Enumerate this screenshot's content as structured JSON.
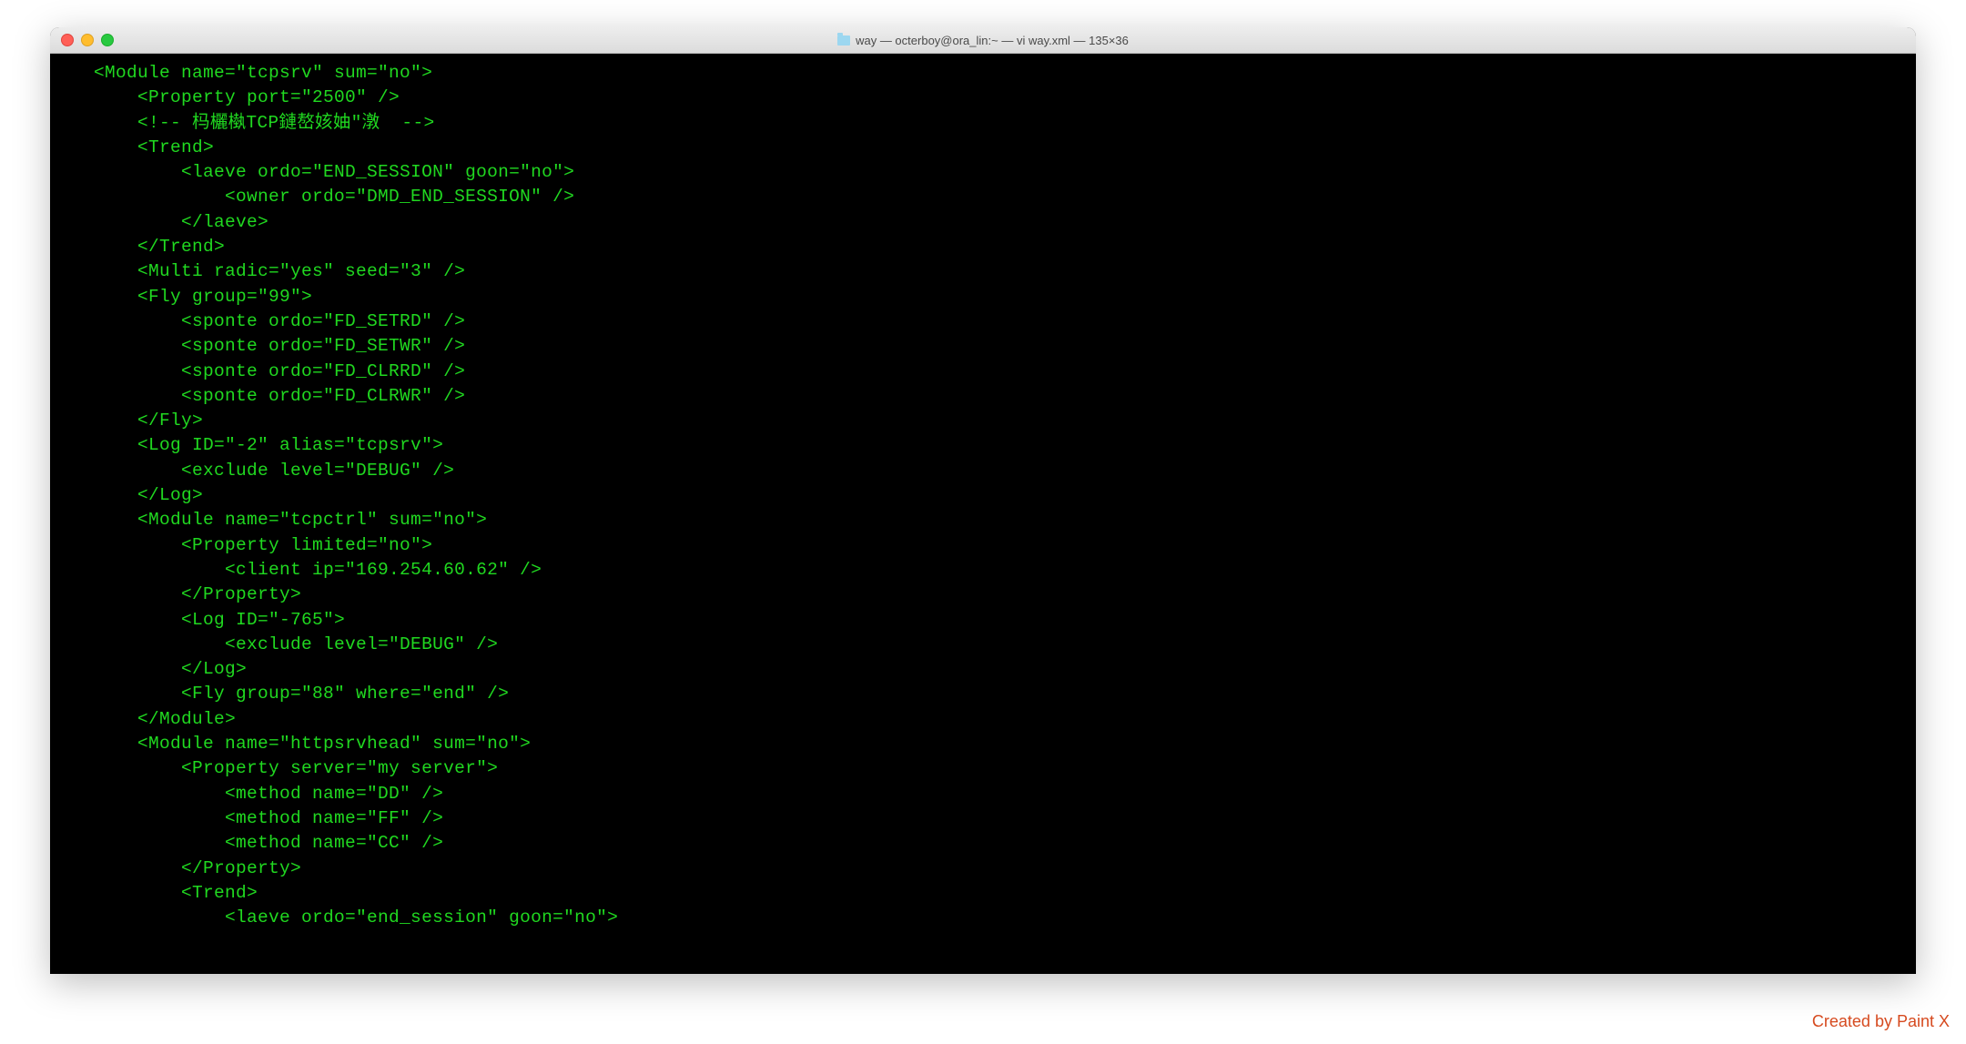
{
  "window": {
    "title": "way — octerboy@ora_lin:~ — vi way.xml — 135×36"
  },
  "terminal": {
    "lines": [
      "    <Module name=\"tcpsrv\" sum=\"no\">",
      "        <Property port=\"2500\" />",
      "        <!-- 杩欐槸TCP鏈嶅姟妯″潡  -->",
      "        <Trend>",
      "            <laeve ordo=\"END_SESSION\" goon=\"no\">",
      "                <owner ordo=\"DMD_END_SESSION\" />",
      "            </laeve>",
      "        </Trend>",
      "        <Multi radic=\"yes\" seed=\"3\" />",
      "        <Fly group=\"99\">",
      "            <sponte ordo=\"FD_SETRD\" />",
      "            <sponte ordo=\"FD_SETWR\" />",
      "            <sponte ordo=\"FD_CLRRD\" />",
      "            <sponte ordo=\"FD_CLRWR\" />",
      "        </Fly>",
      "        <Log ID=\"-2\" alias=\"tcpsrv\">",
      "            <exclude level=\"DEBUG\" />",
      "        </Log>",
      "        <Module name=\"tcpctrl\" sum=\"no\">",
      "            <Property limited=\"no\">",
      "                <client ip=\"169.254.60.62\" />",
      "            </Property>",
      "            <Log ID=\"-765\">",
      "                <exclude level=\"DEBUG\" />",
      "            </Log>",
      "            <Fly group=\"88\" where=\"end\" />",
      "        </Module>",
      "        <Module name=\"httpsrvhead\" sum=\"no\">",
      "            <Property server=\"my server\">",
      "                <method name=\"DD\" />",
      "                <method name=\"FF\" />",
      "                <method name=\"CC\" />",
      "            </Property>",
      "            <Trend>",
      "                <laeve ordo=\"end_session\" goon=\"no\">"
    ]
  },
  "watermark": "Created by Paint X"
}
